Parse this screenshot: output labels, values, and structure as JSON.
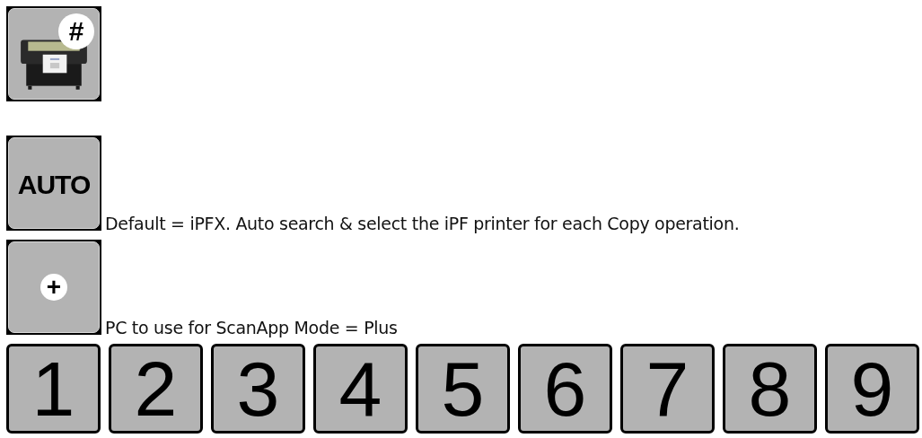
{
  "rows": [
    {
      "button": {
        "kind": "printer",
        "badge": "#"
      }
    },
    {
      "button": {
        "kind": "text",
        "label": "AUTO"
      },
      "caption": "Default = iPFX. Auto search & select the iPF printer for each Copy operation."
    },
    {
      "button": {
        "kind": "plus",
        "symbol": "+"
      },
      "caption": "PC to use for ScanApp Mode = Plus"
    }
  ],
  "number_keys": [
    "1",
    "2",
    "3",
    "4",
    "5",
    "6",
    "7",
    "8",
    "9"
  ]
}
